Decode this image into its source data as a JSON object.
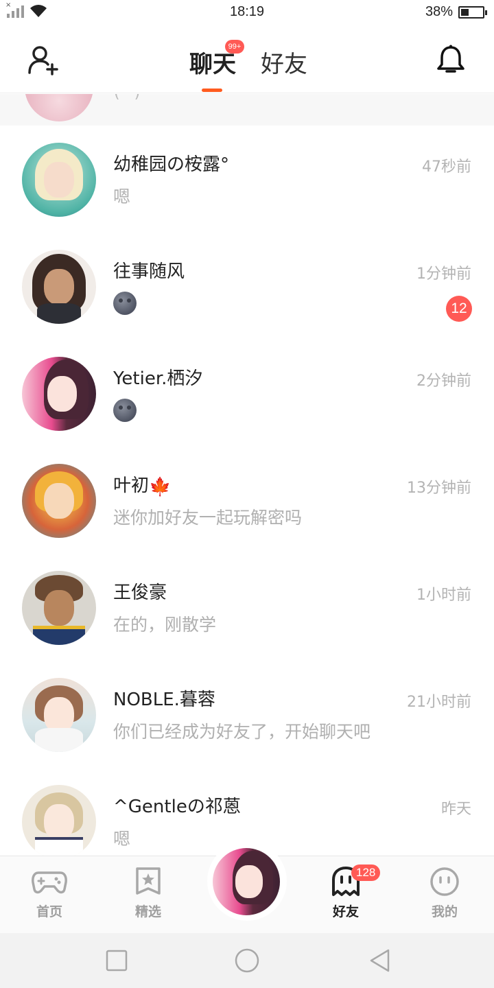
{
  "status_bar": {
    "time": "18:19",
    "battery_percent": "38%",
    "battery_level": 0.38
  },
  "header": {
    "tabs": [
      {
        "label": "聊天",
        "active": true,
        "badge": "99+"
      },
      {
        "label": "好友",
        "active": false
      }
    ],
    "left_icon": "add-friend-icon",
    "right_icon": "bell-icon"
  },
  "partial_row": {
    "preview": "( · )"
  },
  "chats": [
    {
      "name": "幼稚园の桉露°",
      "preview": "嗯",
      "time": "47秒前",
      "unread": "",
      "preview_emoji": false
    },
    {
      "name": "往事随风",
      "preview": "",
      "time": "1分钟前",
      "unread": "12",
      "preview_emoji": true
    },
    {
      "name": "Yetier.栖汐",
      "preview": "",
      "time": "2分钟前",
      "unread": "",
      "preview_emoji": true
    },
    {
      "name": "叶初",
      "name_emoji": "🍁",
      "preview": "迷你加好友一起玩解密吗",
      "time": "13分钟前",
      "unread": "",
      "preview_emoji": false
    },
    {
      "name": "王俊豪",
      "preview": "在的，刚散学",
      "time": "1小时前",
      "unread": "",
      "preview_emoji": false
    },
    {
      "name": "NOBLE.暮蓉",
      "preview": "你们已经成为好友了，开始聊天吧",
      "time": "21小时前",
      "unread": "",
      "preview_emoji": false
    },
    {
      "name": "^Gentleの祁蒽",
      "preview": "嗯",
      "time": "昨天",
      "unread": "",
      "preview_emoji": false
    }
  ],
  "bottom_nav": {
    "items": [
      {
        "label": "首页",
        "icon": "gamepad-icon"
      },
      {
        "label": "精选",
        "icon": "star-bookmark-icon"
      },
      {
        "label": "",
        "icon": "profile-avatar"
      },
      {
        "label": "好友",
        "icon": "ghost-icon",
        "badge": "128",
        "active": true
      },
      {
        "label": "我的",
        "icon": "smiley-face-icon"
      }
    ]
  },
  "colors": {
    "accent": "#ff5b1f",
    "badge": "#ff5a55",
    "muted_text": "#b0b0b0"
  }
}
